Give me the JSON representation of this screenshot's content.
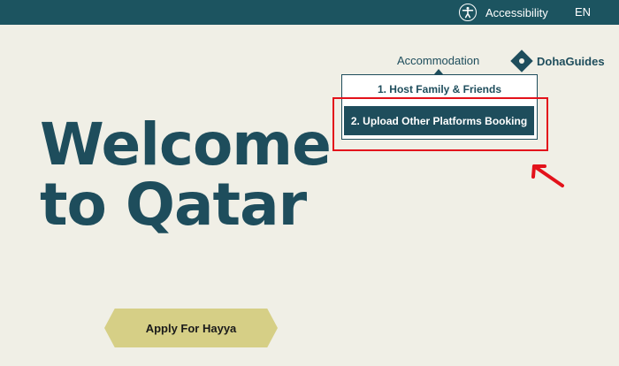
{
  "topbar": {
    "accessibility_label": "Accessibility",
    "accessibility_icon": "accessibility-icon",
    "language": "EN"
  },
  "nav": {
    "accommodation": "Accommodation",
    "doha_guides": "DohaGuides",
    "doha_guides_icon": "doha-guides-logo-icon"
  },
  "dropdown": {
    "items": [
      {
        "label": "1. Host Family & Friends"
      },
      {
        "label": "2. Upload Other Platforms Booking"
      }
    ]
  },
  "hero": {
    "line1": "Welcome",
    "line2": "to Qatar"
  },
  "cta": {
    "apply_label": "Apply For Hayya"
  },
  "colors": {
    "background": "#f0efe6",
    "topbar": "#1c5460",
    "text_primary": "#1e4d5c",
    "cta": "#d6cf86",
    "annotation": "#e3121b"
  }
}
